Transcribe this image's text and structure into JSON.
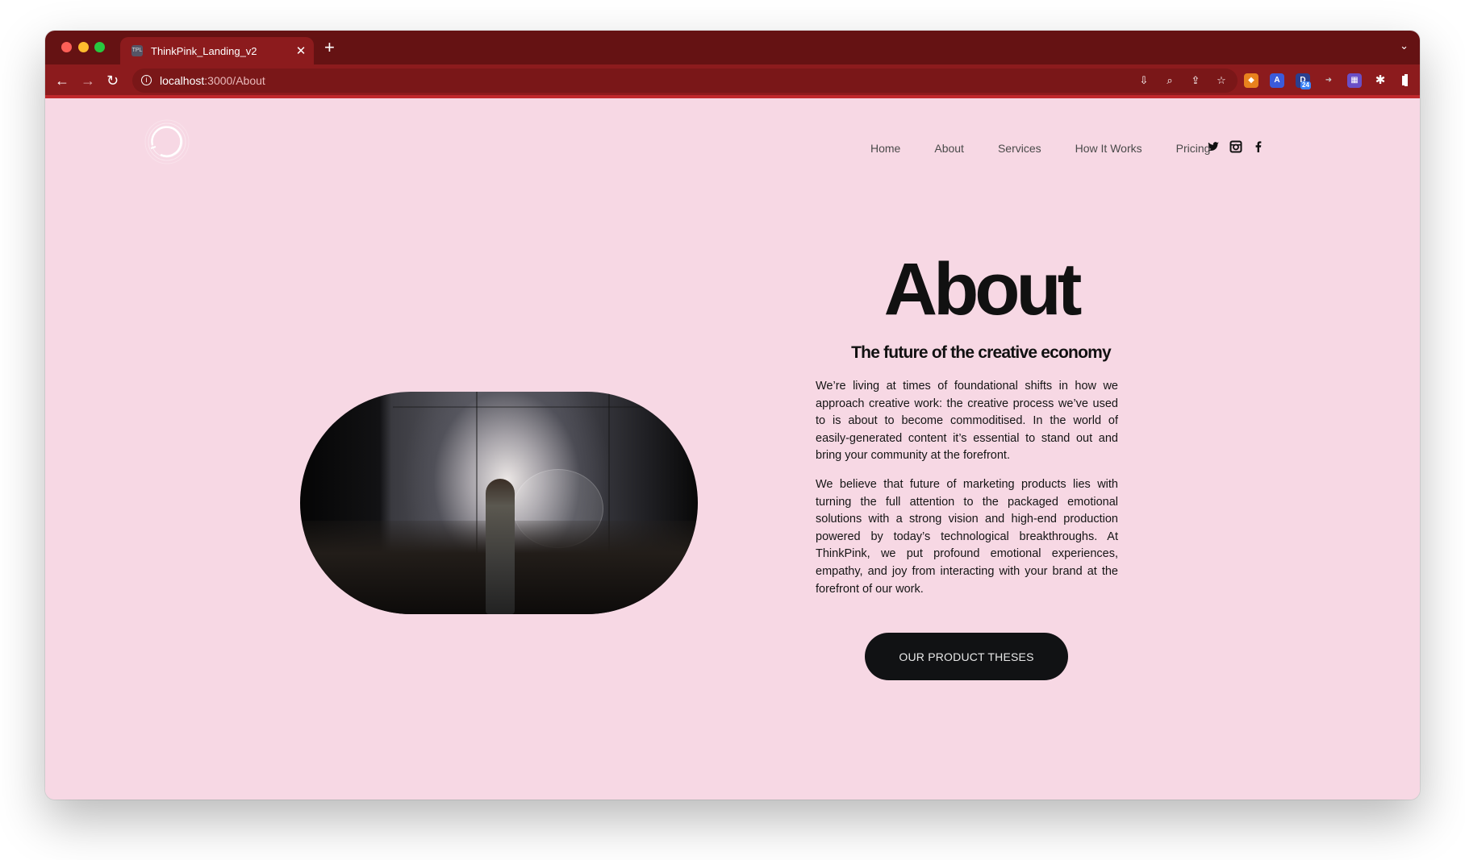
{
  "browser": {
    "tab_title": "ThinkPink_Landing_v2",
    "tab_favicon_text": "TPL",
    "url_host": "localhost",
    "url_path": ":3000/About",
    "extension_badge": "24"
  },
  "site": {
    "nav": [
      "Home",
      "About",
      "Services",
      "How It Works",
      "Pricing"
    ],
    "social": [
      "twitter-icon",
      "instagram-icon",
      "facebook-icon"
    ]
  },
  "hero": {
    "title": "About",
    "subtitle": "The future of the creative economy",
    "paragraph1": "We’re living at times of foundational shifts in how we approach creative work: the creative process we’ve used to is about to become commoditised. In the world of easily-generated content it’s essential to stand out and bring your community at the forefront.",
    "paragraph2": "We believe that future of marketing products lies with turning the full attention to the packaged emotional solutions with a strong vision and high-end production powered by today’s technological breakthroughs. At ThinkPink, we put profound emotional experiences, empathy, and joy from interacting with your brand at the forefront of our work.",
    "cta_label": "OUR PRODUCT THESES"
  },
  "colors": {
    "page_background": "#f7d8e4",
    "browser_frame": "#8c1b1d",
    "button": "#111214"
  }
}
